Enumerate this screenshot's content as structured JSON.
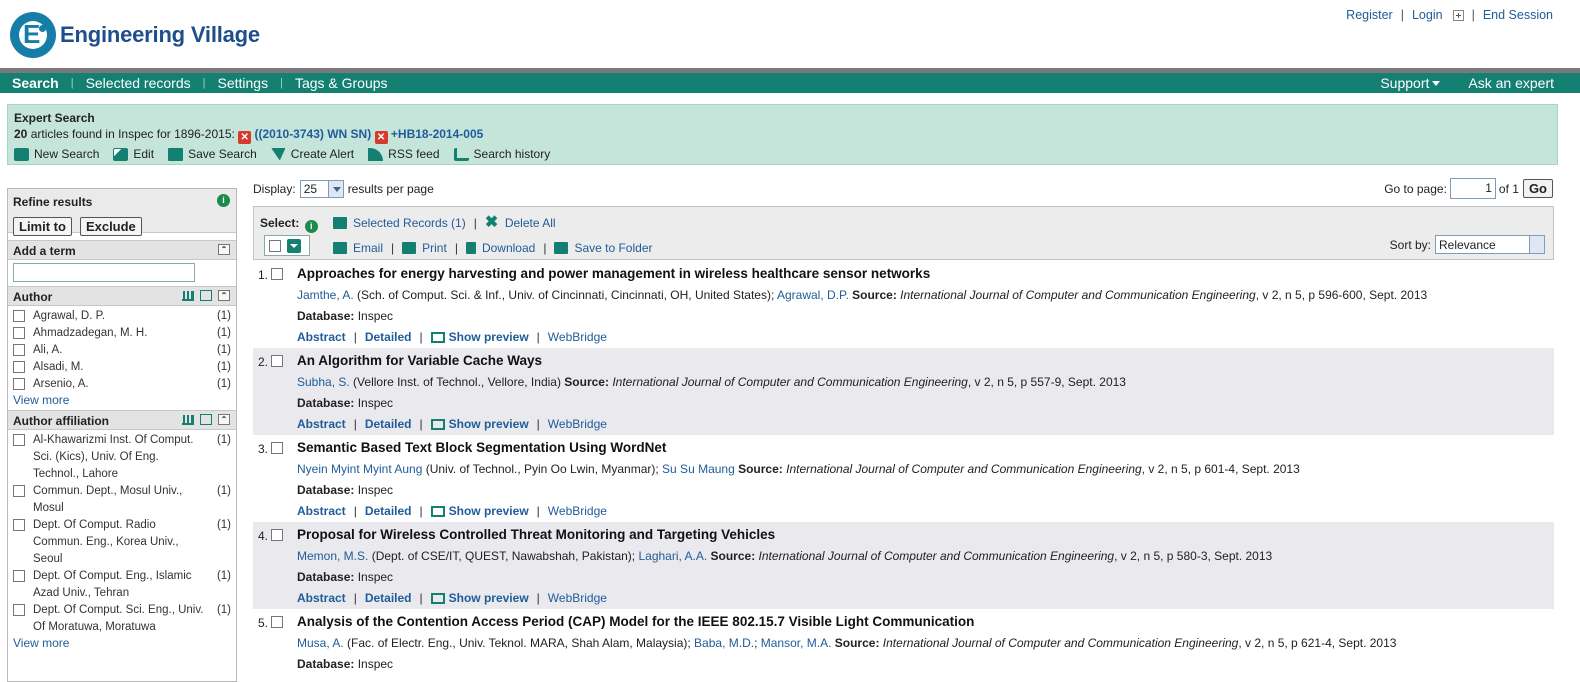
{
  "brand": {
    "name": "Engineering Village",
    "mark": "E"
  },
  "header_links": {
    "register": "Register",
    "login": "Login",
    "end_session": "End Session"
  },
  "nav": {
    "items": [
      "Search",
      "Selected records",
      "Settings",
      "Tags & Groups"
    ],
    "support": "Support",
    "ask": "Ask an expert"
  },
  "summary": {
    "title": "Expert Search",
    "count": "20",
    "count_text": " articles found in Inspec for 1896-2015: ",
    "query1": "((2010-3743) WN SN)",
    "query2": "+HB18-2014-005",
    "tools": [
      "New Search",
      "Edit",
      "Save Search",
      "Create Alert",
      "RSS feed",
      "Search history"
    ]
  },
  "sidebar": {
    "refine": "Refine results",
    "limit": "Limit to",
    "exclude": "Exclude",
    "add_term": "Add a term",
    "author_title": "Author",
    "authors": [
      {
        "label": "Agrawal, D. P.",
        "count": "(1)"
      },
      {
        "label": "Ahmadzadegan, M. H.",
        "count": "(1)"
      },
      {
        "label": "Ali, A.",
        "count": "(1)"
      },
      {
        "label": "Alsadi, M.",
        "count": "(1)"
      },
      {
        "label": "Arsenio, A.",
        "count": "(1)"
      }
    ],
    "view_more": "View more",
    "affil_title": "Author affiliation",
    "affils": [
      {
        "label": "Al-Khawarizmi Inst. Of Comput. Sci. (Kics), Univ. Of Eng. Technol., Lahore",
        "count": "(1)"
      },
      {
        "label": "Commun. Dept., Mosul Univ., Mosul",
        "count": "(1)"
      },
      {
        "label": "Dept. Of Comput. Radio Commun. Eng., Korea Univ., Seoul",
        "count": "(1)"
      },
      {
        "label": "Dept. Of Comput. Eng., Islamic Azad Univ., Tehran",
        "count": "(1)"
      },
      {
        "label": "Dept. Of Comput. Sci. Eng., Univ. Of Moratuwa, Moratuwa",
        "count": "(1)"
      }
    ],
    "view_more2": "View more"
  },
  "display": {
    "label": "Display:",
    "value": "25",
    "suffix": "results per page"
  },
  "goto": {
    "label": "Go to page:",
    "value": "1",
    "of": "of 1",
    "go": "Go"
  },
  "toolbar": {
    "select": "Select:",
    "selected_records": "Selected Records (1)",
    "delete_all": "Delete All",
    "email": "Email",
    "print": "Print",
    "download": "Download",
    "save_folder": "Save to Folder",
    "sort_label": "Sort by:",
    "sort_value": "Relevance"
  },
  "results": [
    {
      "num": "1.",
      "title": "Approaches for energy harvesting and power management in wireless healthcare sensor networks",
      "a1": "Jamthe, A.",
      "aff1": " (Sch. of Comput. Sci. & Inf., Univ. of Cincinnati, Cincinnati, OH, United States); ",
      "a2": "Agrawal, D.P.",
      "a3": "",
      "source_label": "  Source: ",
      "journal": "International Journal of Computer and Communication Engineering",
      "details": ", v 2, n 5, p 596-600, Sept. 2013"
    },
    {
      "num": "2.",
      "title": "An Algorithm for Variable Cache Ways",
      "a1": "Subha, S.",
      "aff1": " (Vellore Inst. of Technol., Vellore, India) ",
      "a2": "",
      "a3": "",
      "source_label": " Source: ",
      "journal": "International Journal of Computer and Communication Engineering",
      "details": ", v 2, n 5, p 557-9, Sept. 2013"
    },
    {
      "num": "3.",
      "title": "Semantic Based Text Block Segmentation Using WordNet",
      "a1": "Nyein Myint Myint Aung",
      "aff1": " (Univ. of Technol., Pyin Oo Lwin, Myanmar); ",
      "a2": "Su Su Maung",
      "a3": "",
      "source_label": "  Source: ",
      "journal": "International Journal of Computer and Communication Engineering",
      "details": ", v 2, n 5, p 601-4, Sept. 2013"
    },
    {
      "num": "4.",
      "title": "Proposal for Wireless Controlled Threat Monitoring and Targeting Vehicles",
      "a1": "Memon, M.S.",
      "aff1": " (Dept. of CSE/IT, QUEST, Nawabshah, Pakistan); ",
      "a2": "Laghari, A.A.",
      "a3": "",
      "source_label": "  Source: ",
      "journal": "International Journal of Computer and Communication Engineering",
      "details": ", v 2, n 5, p 580-3, Sept. 2013"
    },
    {
      "num": "5.",
      "title": "Analysis of the Contention Access Period (CAP) Model for the IEEE 802.15.7 Visible Light Communication",
      "a1": "Musa, A.",
      "aff1": " (Fac. of Electr. Eng., Univ. Teknol. MARA, Shah Alam, Malaysia); ",
      "a2": "Baba, M.D.",
      "a3": "Mansor, M.A.",
      "source_label": "  Source: ",
      "journal": "International Journal of Computer and Communication Engineering",
      "details": ", v 2, n 5, p 621-4, Sept. 2013"
    }
  ],
  "result_meta": {
    "db_label": "Database:",
    "db_value": " Inspec",
    "abstract": "Abstract",
    "detailed": "Detailed",
    "preview": "Show preview",
    "webbridge": "WebBridge"
  },
  "colors": {
    "nav": "#148072",
    "summary": "#c5e5db",
    "link": "#1f5c99",
    "alt_row": "#e9e9ee"
  }
}
